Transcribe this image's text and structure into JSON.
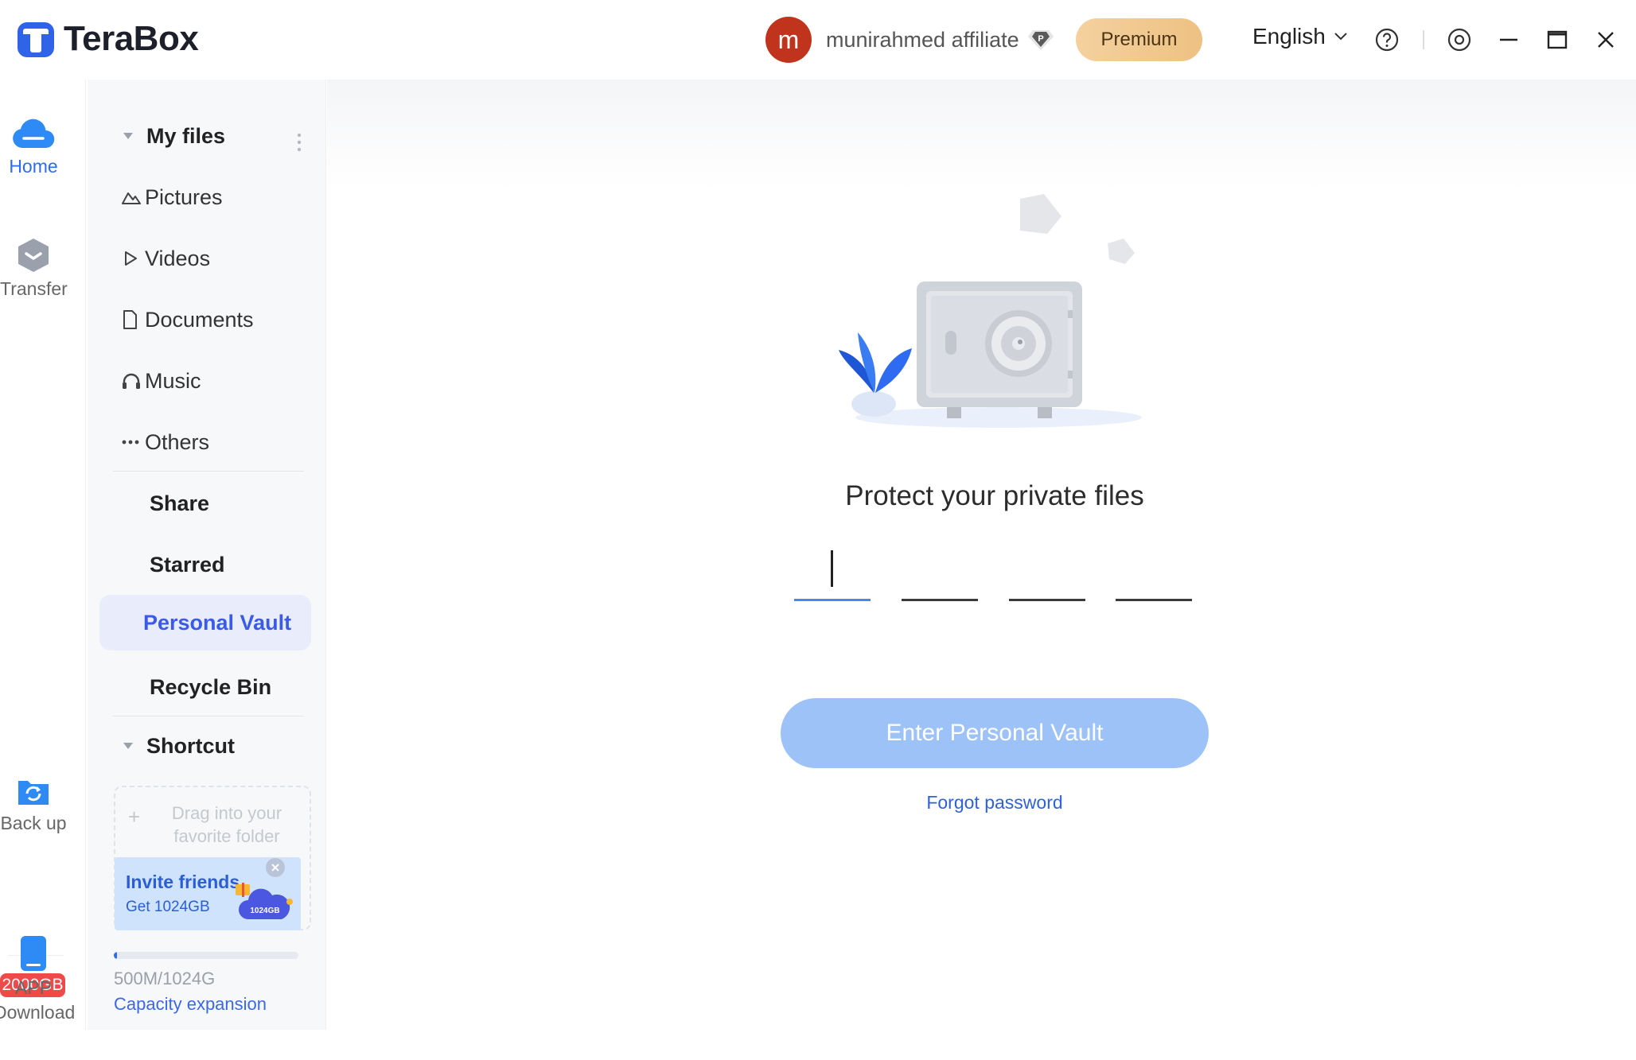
{
  "app": {
    "name": "TeraBox",
    "brand_color": "#2e6bf0"
  },
  "header": {
    "avatar_initial": "m",
    "username": "munirahmed affiliate",
    "badge_icon": "p-badge-icon",
    "premium_label": "Premium",
    "language": "English",
    "icons": [
      "help-icon",
      "settings-icon",
      "minimize-icon",
      "maximize-icon",
      "close-icon"
    ]
  },
  "rail": {
    "home": "Home",
    "transfer": "Transfer",
    "backup": "Back up",
    "storage_badge": "2000GB",
    "app_download_line1": "APP",
    "app_download_line2": "Download"
  },
  "sidebar": {
    "my_files": "My files",
    "items": [
      {
        "label": "Pictures",
        "icon": "picture-icon"
      },
      {
        "label": "Videos",
        "icon": "play-icon"
      },
      {
        "label": "Documents",
        "icon": "document-icon"
      },
      {
        "label": "Music",
        "icon": "headphones-icon"
      },
      {
        "label": "Others",
        "icon": "more-icon"
      }
    ],
    "share": "Share",
    "starred": "Starred",
    "personal_vault": "Personal Vault",
    "recycle_bin": "Recycle Bin",
    "shortcut": "Shortcut",
    "shortcut_placeholder": "Drag into your favorite folder",
    "invite_title": "Invite friends",
    "invite_sub": "Get 1024GB",
    "invite_cloud_label": "1024GB",
    "capacity_text": "500M/1024G",
    "capacity_fraction": 0.0005,
    "capacity_link": "Capacity expansion"
  },
  "vault": {
    "title": "Protect your private files",
    "pin_length": 4,
    "enter_button": "Enter Personal Vault",
    "forgot_password": "Forgot password",
    "button_color": "#9cc2f7"
  }
}
